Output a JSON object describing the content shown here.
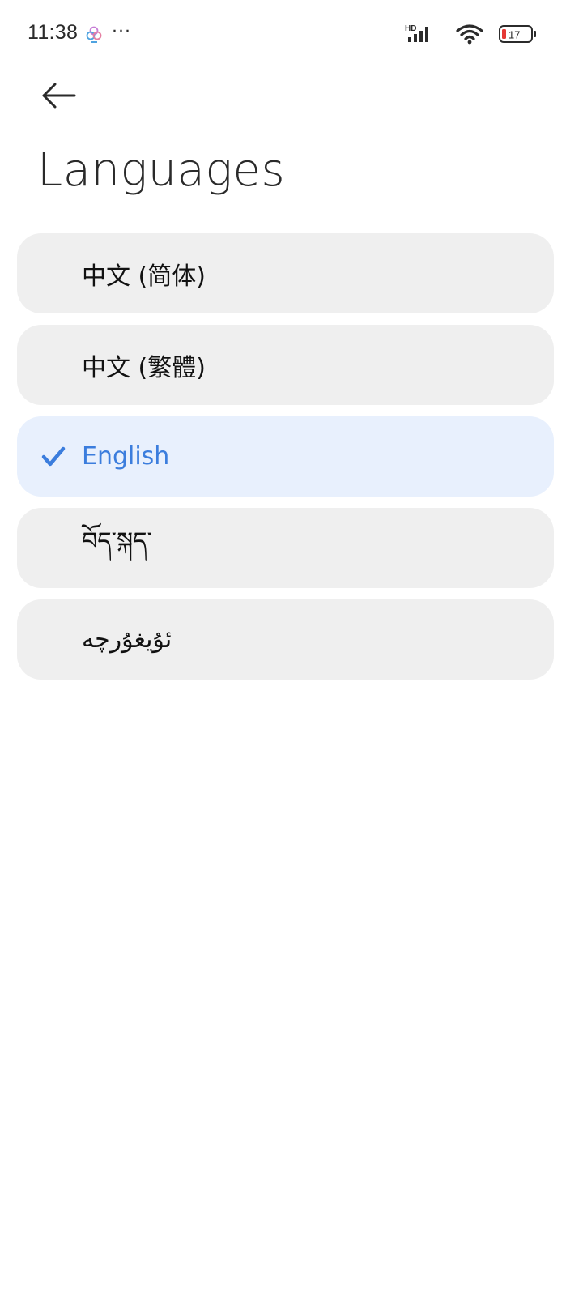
{
  "status_bar": {
    "time": "11:38",
    "more": "···",
    "network": "HD",
    "battery_level": "17",
    "battery_color": "#e53935"
  },
  "header": {
    "back_icon": "arrow-left-icon",
    "title": "Languages"
  },
  "colors": {
    "item_bg": "#efefef",
    "selected_bg": "#e8f0fd",
    "accent": "#3b7ddd"
  },
  "languages": [
    {
      "label": "中文 (简体)",
      "selected": false
    },
    {
      "label": "中文 (繁體)",
      "selected": false
    },
    {
      "label": "English",
      "selected": true
    },
    {
      "label": "བོད་སྐད་",
      "selected": false
    },
    {
      "label": "ئۇيغۇرچە",
      "selected": false
    }
  ]
}
